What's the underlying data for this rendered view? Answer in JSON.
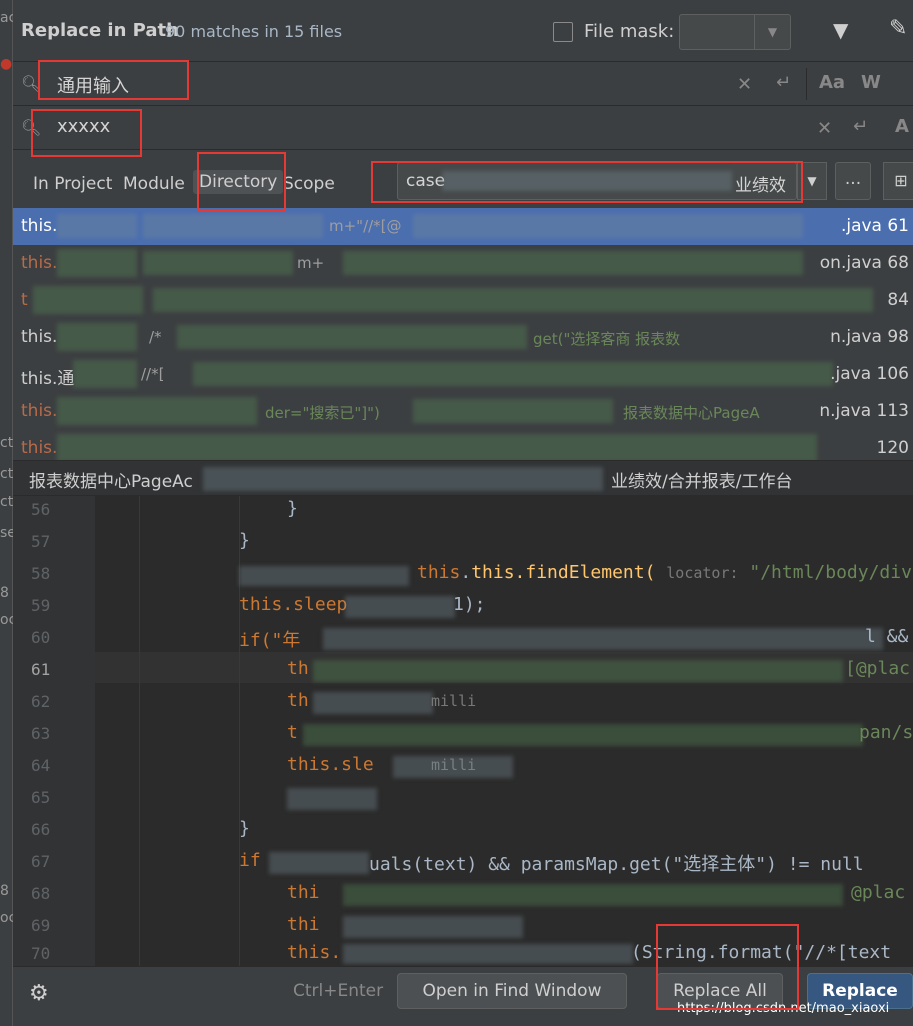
{
  "dialog": {
    "title": "Replace in Path",
    "subtitle": "90 matches in 15 files",
    "file_mask_label": "File mask:",
    "file_mask_value": ""
  },
  "search": {
    "find_value": "通用输入",
    "replace_value": "xxxxx",
    "opt_case": "Aa",
    "opt_words": "W"
  },
  "scope": {
    "tabs": [
      {
        "label": "In Project"
      },
      {
        "label": "Module"
      },
      {
        "label": "Directory"
      },
      {
        "label": "Scope"
      }
    ],
    "selected": "Directory",
    "directory_prefix": "case",
    "directory_suffix": "业绩效",
    "browse_label": "..."
  },
  "results": [
    {
      "prefix": "this.",
      "fragment": "m+\"//*[@",
      "location": ".java 61"
    },
    {
      "prefix": "this.",
      "fragment": "m+",
      "location": "on.java 68"
    },
    {
      "prefix": "t",
      "fragment": "",
      "location": "84"
    },
    {
      "prefix": "this.",
      "fragment": "/*",
      "fragment2": "get(\"选择客商 报表数",
      "location": "n.java 98"
    },
    {
      "prefix": "this.通",
      "fragment": "//*[",
      "location": ".java 106"
    },
    {
      "prefix": "this.",
      "fragment": "der=\"搜索已\"]\")",
      "fragment2": "报表数据中心PageA",
      "location": "n.java 113"
    },
    {
      "prefix": "this.",
      "fragment": "",
      "location": "120"
    }
  ],
  "preview_path": {
    "left": "报表数据中心PageAc",
    "right": "业绩效/合并报表/工作台"
  },
  "editor": {
    "lines": [
      {
        "num": "56",
        "text": "}"
      },
      {
        "num": "57",
        "text": "}"
      },
      {
        "num": "58",
        "text": "this.findElement(",
        "hint": "locator:",
        "tail": "\"/html/body/div[\"+"
      },
      {
        "num": "59",
        "text": "this.sleep",
        "tail": "1);"
      },
      {
        "num": "60",
        "text": "if(\"年",
        "tail": "l &&"
      },
      {
        "num": "61",
        "text": "th",
        "tail": "[@plac"
      },
      {
        "num": "62",
        "text": "th",
        "tail": "milli"
      },
      {
        "num": "63",
        "text": "t",
        "tail": "pan/s"
      },
      {
        "num": "64",
        "text": "this.sle",
        "tail": "milli"
      },
      {
        "num": "65",
        "text": ""
      },
      {
        "num": "66",
        "text": "}"
      },
      {
        "num": "67",
        "text": "if",
        "tail": "uals(text) && paramsMap.get(\"选择主体\") != null"
      },
      {
        "num": "68",
        "text": "thi",
        "tail": "@plac"
      },
      {
        "num": "69",
        "text": "thi",
        "tail": ""
      },
      {
        "num": "70",
        "text": "this.",
        "tail": "(String.format(\"//*[text"
      }
    ]
  },
  "footer": {
    "shortcut": "Ctrl+Enter",
    "open_find": "Open in Find Window",
    "replace_all": "Replace All",
    "replace": "Replace"
  },
  "watermark": "https://blog.csdn.net/mao_xiaoxi",
  "colors": {
    "background": "#3c3f41",
    "selection": "#4b6eaf",
    "primary_button": "#365880",
    "annotation": "#e53935"
  }
}
